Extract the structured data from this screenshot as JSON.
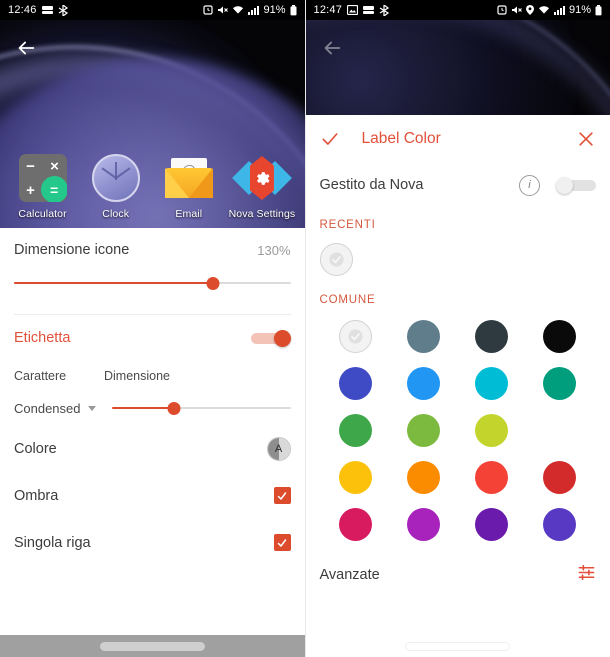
{
  "left": {
    "status": {
      "time": "12:46",
      "battery": "91%",
      "left_icons": [
        "sky-sports-icon",
        "bluetooth-share-icon"
      ],
      "right_icons": [
        "alarm-icon",
        "mute-icon",
        "wifi-icon",
        "signal-icon",
        "battery-icon"
      ]
    },
    "back_label": "back-arrow",
    "apps": [
      {
        "label": "Calculator",
        "icon": "calculator-icon"
      },
      {
        "label": "Clock",
        "icon": "clock-icon"
      },
      {
        "label": "Email",
        "icon": "email-icon"
      },
      {
        "label": "Nova Settings",
        "icon": "nova-settings-icon"
      }
    ],
    "calculator_glyphs": {
      "minus": "−",
      "times": "×",
      "plus": "+",
      "equals": "="
    },
    "email_glyph": "@",
    "settings": {
      "icon_size": {
        "label": "Dimensione icone",
        "value": "130%",
        "percent": 72
      },
      "etichetta": {
        "label": "Etichetta",
        "enabled": true
      },
      "carattere": {
        "label": "Carattere",
        "value": "Condensed"
      },
      "dimensione": {
        "label": "Dimensione",
        "percent": 35
      },
      "colore": {
        "label": "Colore",
        "swatch_letter": "A"
      },
      "ombra": {
        "label": "Ombra",
        "checked": true
      },
      "singola_riga": {
        "label": "Singola riga",
        "checked": true
      }
    }
  },
  "right": {
    "status": {
      "time": "12:47",
      "battery": "91%",
      "left_icons": [
        "image-icon",
        "sky-sports-icon",
        "bluetooth-share-icon"
      ],
      "right_icons": [
        "alarm-icon",
        "mute-icon",
        "location-icon",
        "wifi-icon",
        "signal-icon",
        "battery-icon"
      ]
    },
    "back_label": "back-arrow",
    "dialog": {
      "title": "Label Color",
      "confirm": "confirm-check",
      "close": "close-x",
      "managed": {
        "label": "Gestito da Nova",
        "info": "i",
        "enabled": false
      },
      "recent_header": "RECENTI",
      "recent": [
        {
          "name": "none-selected",
          "color": "#f3f3f3",
          "selected": true
        }
      ],
      "common_header": "COMUNE",
      "common": [
        {
          "name": "default",
          "color": "#f3f3f3",
          "selected": true
        },
        {
          "name": "blue-grey",
          "color": "#607d8b"
        },
        {
          "name": "dark-slate",
          "color": "#2e3a40"
        },
        {
          "name": "black",
          "color": "#0a0a0a"
        },
        {
          "name": "indigo",
          "color": "#3f4bc4"
        },
        {
          "name": "blue",
          "color": "#2196f3"
        },
        {
          "name": "cyan",
          "color": "#00bcd4"
        },
        {
          "name": "teal",
          "color": "#009e7c"
        },
        {
          "name": "green",
          "color": "#3da749"
        },
        {
          "name": "light-green",
          "color": "#7cb93f"
        },
        {
          "name": "lime",
          "color": "#c3d52c"
        },
        {
          "name": "yellow",
          "color": "#f5e councilor"
        },
        {
          "name": "amber",
          "color": "#fcc10a"
        },
        {
          "name": "orange",
          "color": "#fb8c00"
        },
        {
          "name": "red",
          "color": "#f44336"
        },
        {
          "name": "dark-red",
          "color": "#d32b2b"
        },
        {
          "name": "pink",
          "color": "#d81b5f"
        },
        {
          "name": "magenta",
          "color": "#a723bc"
        },
        {
          "name": "deep-purple",
          "color": "#6a1bab"
        },
        {
          "name": "violet",
          "color": "#5839c4"
        }
      ],
      "advanced": {
        "label": "Avanzate",
        "icon": "tune-sliders-icon"
      }
    }
  }
}
